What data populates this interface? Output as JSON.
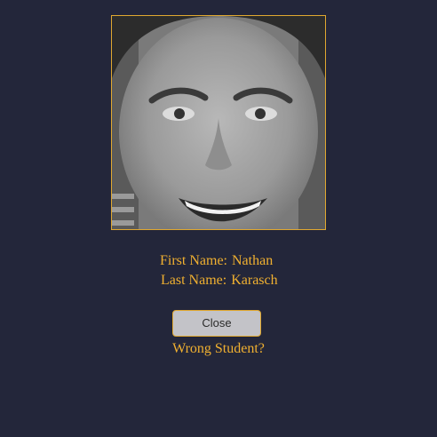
{
  "student": {
    "first_name_label": "First Name:",
    "first_name": "Nathan",
    "last_name_label": "Last Name:",
    "last_name": "Karasch"
  },
  "photo": {
    "alt": "Student photo"
  },
  "actions": {
    "close_label": "Close",
    "wrong_student_label": "Wrong Student?"
  },
  "colors": {
    "background": "#23263a",
    "accent": "#f0b030",
    "button": "#c3c3c8"
  }
}
